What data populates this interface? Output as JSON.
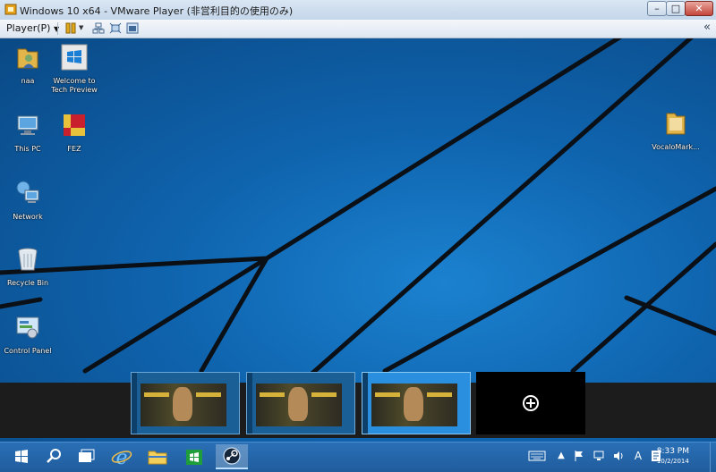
{
  "window": {
    "title": "Windows 10 x64 - VMware Player (非営利目的の使用のみ)",
    "controls": {
      "minimize": "–",
      "maximize": "□",
      "close": "✕"
    }
  },
  "toolbar": {
    "player_menu": "Player(P)",
    "collapse_glyph": "«",
    "icons": [
      "pause-icon",
      "send-ctrl-alt-del-icon",
      "fullscreen-icon",
      "unity-icon"
    ]
  },
  "desktop": {
    "icons": [
      {
        "label": "naa",
        "icon": "user-folder-icon"
      },
      {
        "label": "Welcome to Tech Preview",
        "icon": "windows-logo-icon"
      },
      {
        "label": "This PC",
        "icon": "computer-icon"
      },
      {
        "label": "FEZ",
        "icon": "fez-game-icon"
      },
      {
        "label": "Network",
        "icon": "network-icon"
      },
      {
        "label": "Recycle Bin",
        "icon": "recycle-bin-icon"
      },
      {
        "label": "Control Panel",
        "icon": "control-panel-icon"
      },
      {
        "label": "VocaloMark...",
        "icon": "folder-icon"
      }
    ],
    "wallpaper_colors": {
      "light": "#1b82d0",
      "mid": "#0f63ad",
      "dark": "#0a4985",
      "lines": "#0b0f16"
    }
  },
  "task_view": {
    "desktops": [
      {
        "name": "desktop-1-thumbnail"
      },
      {
        "name": "desktop-2-thumbnail"
      },
      {
        "name": "desktop-3-thumbnail",
        "active": true
      }
    ],
    "add_desktop_icon": "plus-circle-icon"
  },
  "taskbar": {
    "buttons": [
      "start-icon",
      "search-icon",
      "task-view-icon",
      "internet-explorer-icon",
      "file-explorer-icon",
      "store-icon",
      "steam-icon"
    ],
    "tray": [
      "keyboard-icon",
      "chevron-up-icon",
      "flag-icon",
      "network-tray-icon",
      "volume-icon",
      "ime-icon",
      "notification-icon"
    ],
    "ime_label": "A",
    "clock": {
      "time": "8:33 PM",
      "date": "10/2/2014"
    }
  },
  "colors": {
    "taskbar": "#1f5c9c",
    "accent": "#2b8fe0",
    "titlebar": "#c4d6ea"
  }
}
